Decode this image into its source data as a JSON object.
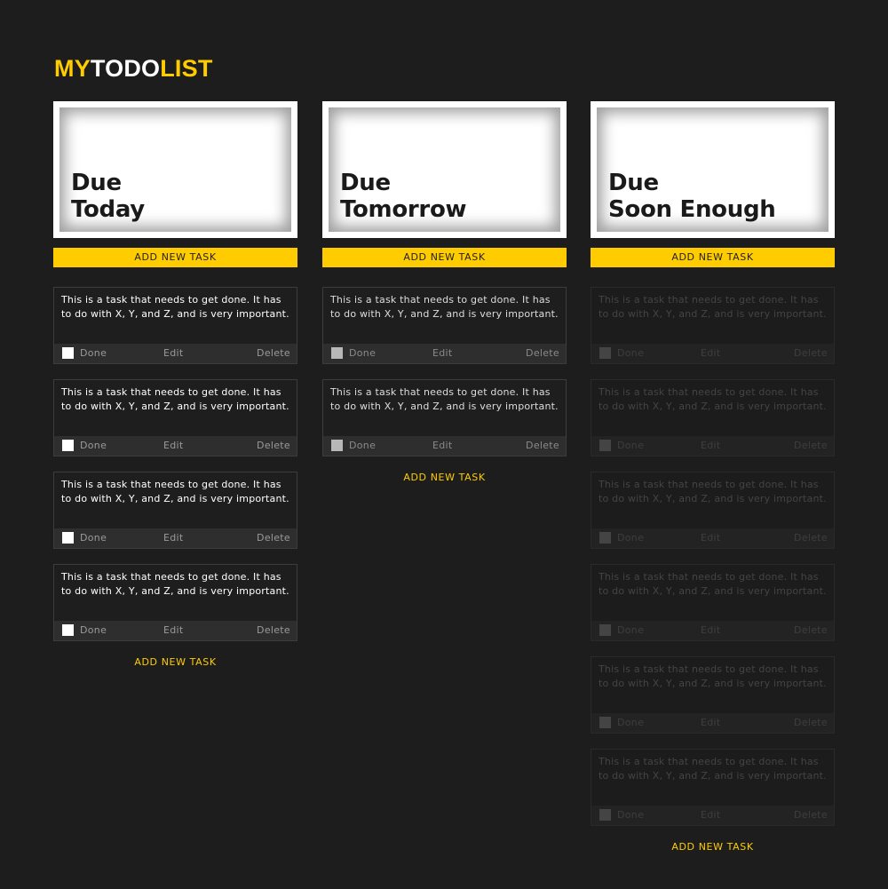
{
  "logo": {
    "my": "MY",
    "todo": "TODO",
    "list": "LIST"
  },
  "columns": [
    {
      "title_line1": "Due",
      "title_line2": "Today",
      "add_bar_label": "ADD NEW TASK",
      "add_link_label": "ADD NEW TASK",
      "tasks": [
        {
          "text": "This is a task that needs to get done. It has to do with X, Y, and Z, and is very important.",
          "done": "Done",
          "edit": "Edit",
          "delete": "Delete"
        },
        {
          "text": "This is a task that needs to get done. It has to do with X, Y, and Z, and is very important.",
          "done": "Done",
          "edit": "Edit",
          "delete": "Delete"
        },
        {
          "text": "This is a task that needs to get done. It has to do with X, Y, and Z, and is very important.",
          "done": "Done",
          "edit": "Edit",
          "delete": "Delete"
        },
        {
          "text": "This is a task that needs to get done. It has to do with X, Y, and Z, and is very important.",
          "done": "Done",
          "edit": "Edit",
          "delete": "Delete"
        }
      ]
    },
    {
      "title_line1": "Due",
      "title_line2": "Tomorrow",
      "add_bar_label": "ADD NEW TASK",
      "add_link_label": "ADD NEW TASK",
      "tasks": [
        {
          "text": "This is a task that needs to get done. It has to do with X, Y, and Z, and is very important.",
          "done": "Done",
          "edit": "Edit",
          "delete": "Delete"
        },
        {
          "text": "This is a task that needs to get done. It has to do with X, Y, and Z, and is very important.",
          "done": "Done",
          "edit": "Edit",
          "delete": "Delete"
        }
      ]
    },
    {
      "title_line1": "Due",
      "title_line2": "Soon Enough",
      "add_bar_label": "ADD NEW TASK",
      "add_link_label": "ADD NEW TASK",
      "tasks": [
        {
          "text": "This is a task that needs to get done. It has to do with X, Y, and Z, and is very important.",
          "done": "Done",
          "edit": "Edit",
          "delete": "Delete"
        },
        {
          "text": "This is a task that needs to get done. It has to do with X, Y, and Z, and is very important.",
          "done": "Done",
          "edit": "Edit",
          "delete": "Delete"
        },
        {
          "text": "This is a task that needs to get done. It has to do with X, Y, and Z, and is very important.",
          "done": "Done",
          "edit": "Edit",
          "delete": "Delete"
        },
        {
          "text": "This is a task that needs to get done. It has to do with X, Y, and Z, and is very important.",
          "done": "Done",
          "edit": "Edit",
          "delete": "Delete"
        },
        {
          "text": "This is a task that needs to get done. It has to do with X, Y, and Z, and is very important.",
          "done": "Done",
          "edit": "Edit",
          "delete": "Delete"
        },
        {
          "text": "This is a task that needs to get done. It has to do with X, Y, and Z, and is very important.",
          "done": "Done",
          "edit": "Edit",
          "delete": "Delete"
        }
      ]
    }
  ],
  "colors": {
    "accent": "#ffcc00",
    "background": "#1d1d1d"
  }
}
